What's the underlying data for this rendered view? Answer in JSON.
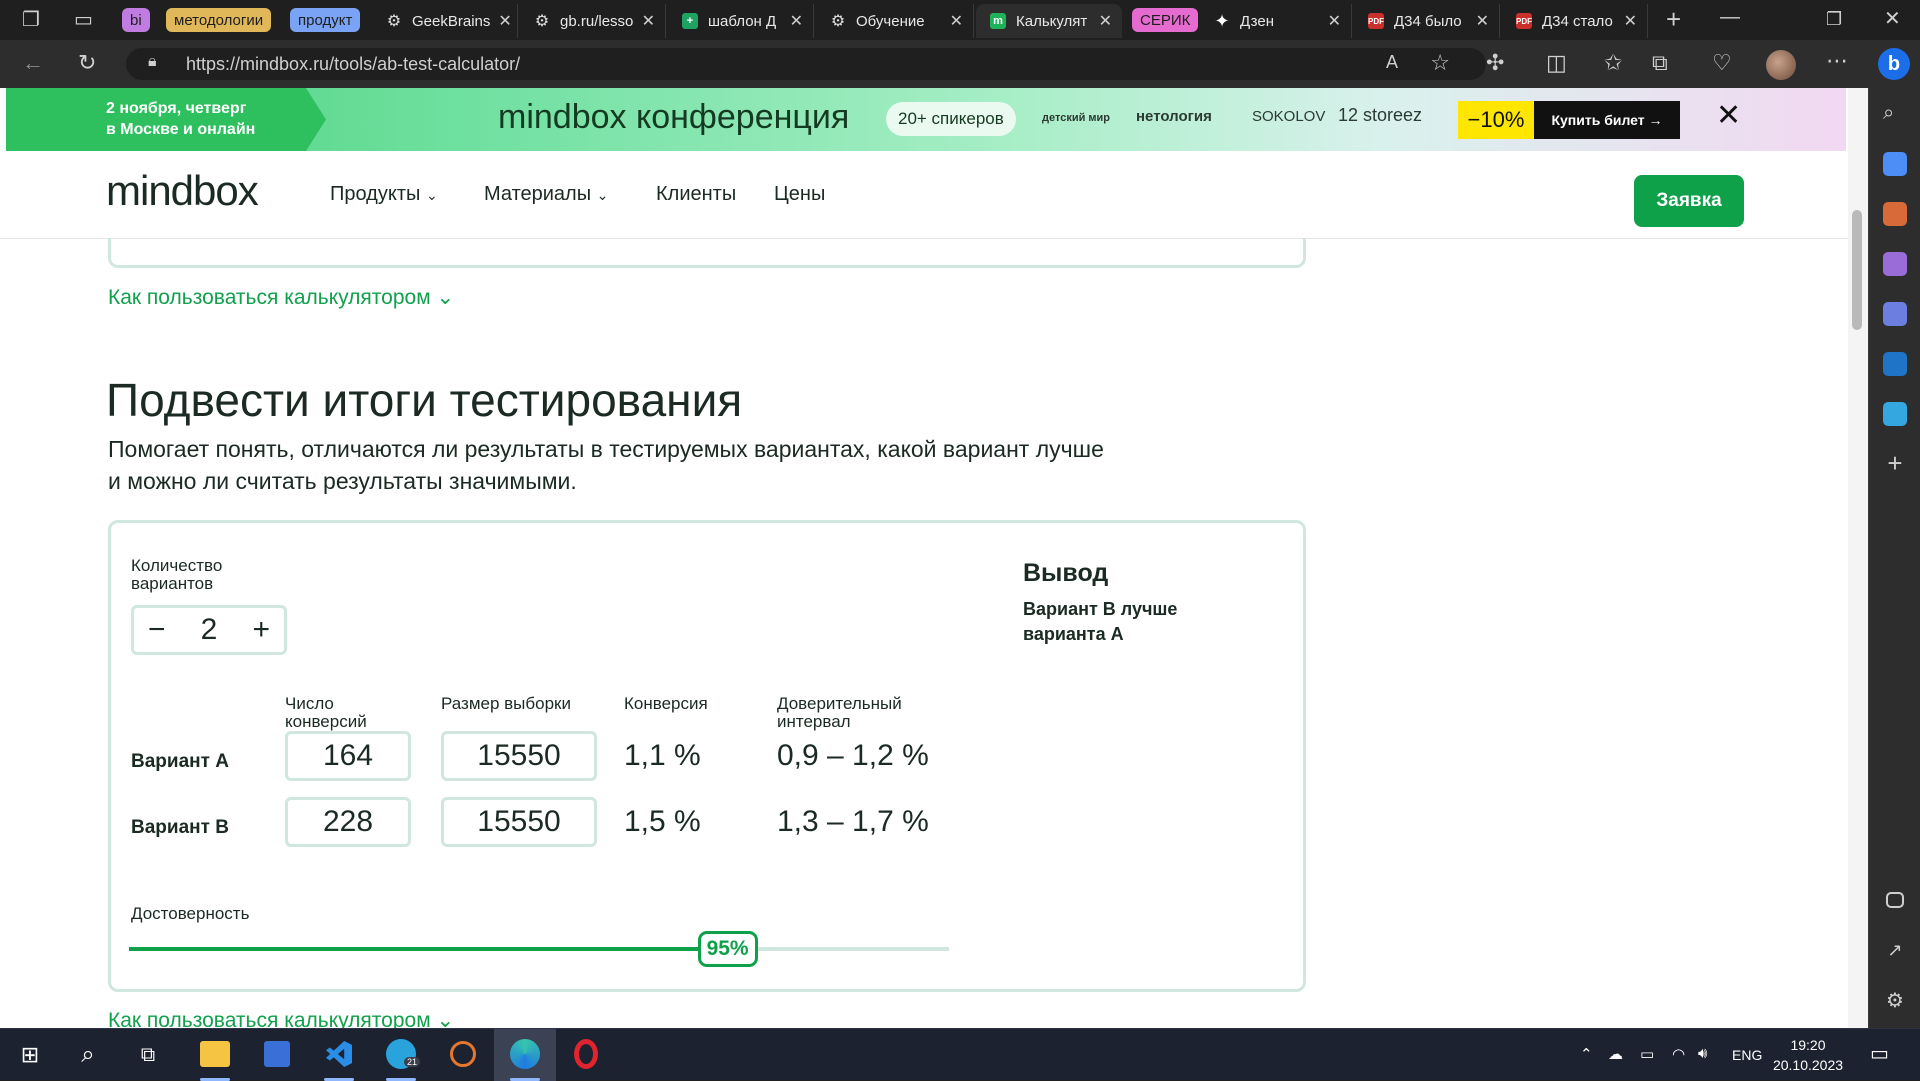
{
  "browser": {
    "tabs": [
      {
        "label": "GeekBrains",
        "icon": "openai-icon"
      },
      {
        "label": "gb.ru/lesso",
        "icon": "openai-icon"
      },
      {
        "label": "шаблон Д",
        "icon": "sheets-icon"
      },
      {
        "label": "Обучение",
        "icon": "openai-icon"
      },
      {
        "label": "Калькулят",
        "icon": "mindbox-icon",
        "active": true
      },
      {
        "label": "Дзен",
        "icon": "dzen-icon"
      },
      {
        "label": "Д34 было",
        "icon": "pdf-icon"
      },
      {
        "label": "Д34 стало",
        "icon": "pdf-icon"
      }
    ],
    "groups": [
      {
        "label": "bi",
        "color": "#c07ce0"
      },
      {
        "label": "методологии",
        "color": "#e0b85a"
      },
      {
        "label": "продукт",
        "color": "#7aa3f5"
      },
      {
        "label": "СЕРИК",
        "color": "#e56bd0"
      }
    ],
    "url": "https://mindbox.ru/tools/ab-test-calculator/"
  },
  "banner": {
    "date_line1": "2 ноября, четверг",
    "date_line2": "в Москве и онлайн",
    "title": "mindbox конференция",
    "pill": "20+ спикеров",
    "brands": [
      "детский мир",
      "нетология",
      "SOKOLOV",
      "12 storeez"
    ],
    "sale": "−10%",
    "buy": "Купить билет →"
  },
  "nav": {
    "logo": "mindbox",
    "items": [
      "Продукты",
      "Материалы",
      "Клиенты",
      "Цены"
    ],
    "apply": "Заявка"
  },
  "howto_link": "Как пользоваться калькулятором ⌄",
  "section": {
    "title": "Подвести итоги тестирования",
    "lead_line1": "Помогает понять, отличаются ли результаты в тестируемых вариантах, какой вариант лучше",
    "lead_line2": "и можно ли считать результаты значимыми."
  },
  "calculator": {
    "variants_label_1": "Количество",
    "variants_label_2": "вариантов",
    "variants_count": "2",
    "col_conversions_1": "Число",
    "col_conversions_2": "конверсий",
    "col_sample": "Размер выборки",
    "col_conversion": "Конверсия",
    "col_ci_1": "Доверительный",
    "col_ci_2": "интервал",
    "rows": [
      {
        "name": "Вариант А",
        "conversions": "164",
        "sample": "15550",
        "conversion": "1,1 %",
        "ci": "0,9 – 1,2 %"
      },
      {
        "name": "Вариант В",
        "conversions": "228",
        "sample": "15550",
        "conversion": "1,5 %",
        "ci": "1,3 – 1,7 %"
      }
    ],
    "output_title": "Вывод",
    "output_text": "Вариант В лучше варианта А",
    "confidence_label": "Достоверность",
    "confidence_value": "95%",
    "confidence_fraction": 0.73
  },
  "taskbar": {
    "lang": "ENG",
    "time": "19:20",
    "date": "20.10.2023",
    "telegram_badge": "21"
  }
}
